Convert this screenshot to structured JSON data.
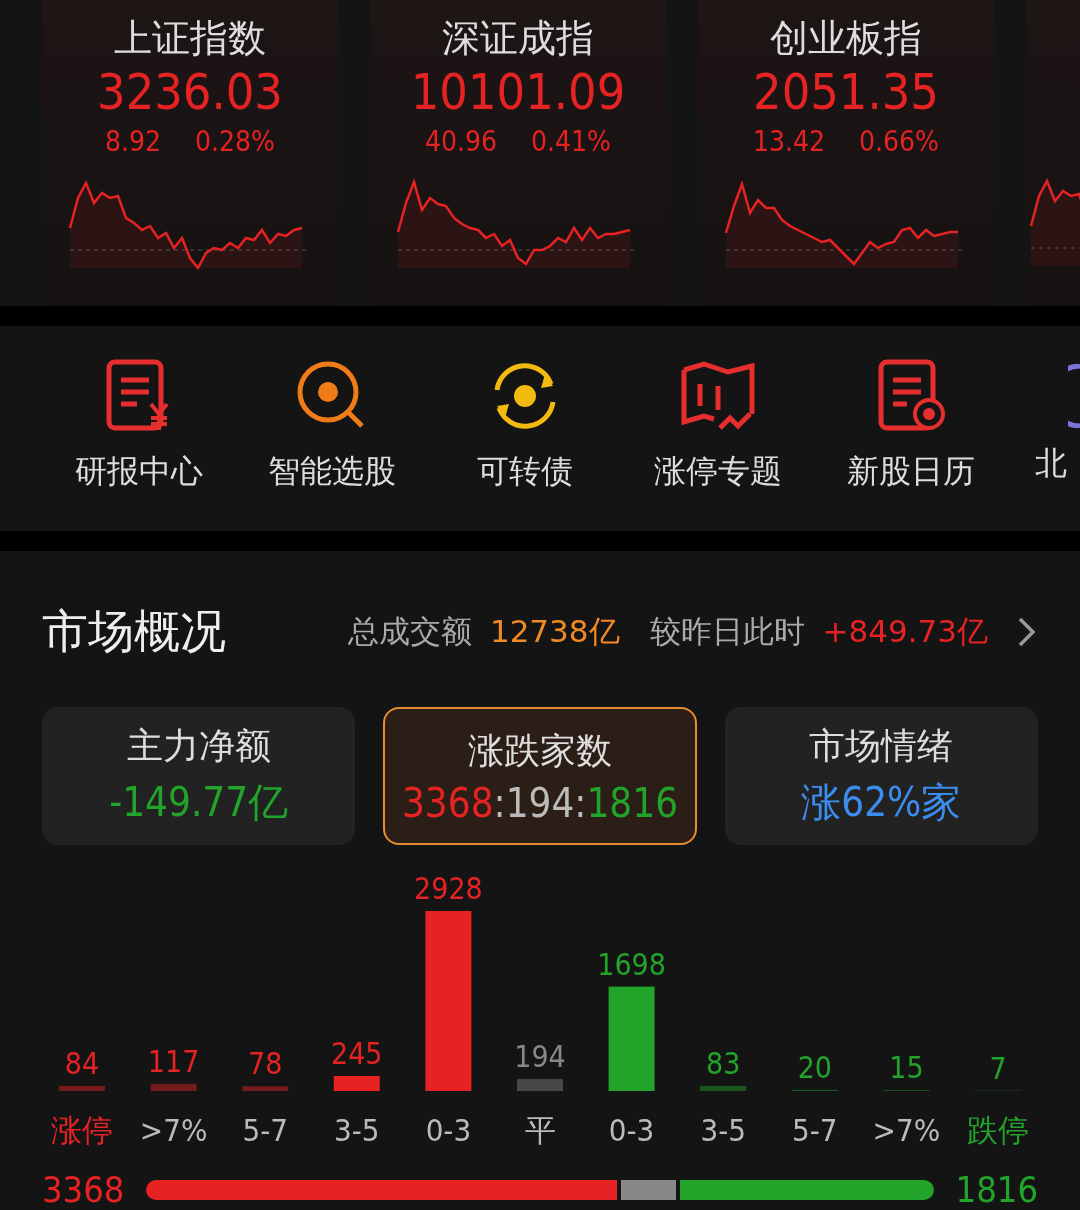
{
  "indices": [
    {
      "name": "上证指数",
      "value": "3236.03",
      "change": "8.92",
      "percent": "0.28%"
    },
    {
      "name": "深证成指",
      "value": "10101.09",
      "change": "40.96",
      "percent": "0.41%"
    },
    {
      "name": "创业板指",
      "value": "2051.35",
      "change": "13.42",
      "percent": "0.66%"
    }
  ],
  "shortcuts": [
    {
      "label": "研报中心",
      "kind": "report"
    },
    {
      "label": "智能选股",
      "kind": "pick"
    },
    {
      "label": "可转债",
      "kind": "bond"
    },
    {
      "label": "涨停专题",
      "kind": "topic"
    },
    {
      "label": "新股日历",
      "kind": "ipo"
    },
    {
      "label": "北",
      "kind": "partial"
    }
  ],
  "overview": {
    "title": "市场概况",
    "turnover_label": "总成交额",
    "turnover": "12738亿",
    "compare_label": "较昨日此时",
    "compare": "+849.73亿",
    "tabs": [
      {
        "title": "主力净额",
        "value": "-149.77亿",
        "color": "#22a32a",
        "selected": false
      },
      {
        "title": "涨跌家数",
        "parts": [
          "3368",
          ":",
          "194",
          ":",
          "1816"
        ],
        "selected": true
      },
      {
        "title": "市场情绪",
        "value": "涨62%家",
        "color": "#3b8ef0",
        "selected": false
      }
    ],
    "chart_data": {
      "type": "bar",
      "categories": [
        "涨停",
        ">7%",
        "5-7",
        "3-5",
        "0-3",
        "平",
        "0-3",
        "3-5",
        "5-7",
        ">7%",
        "跌停"
      ],
      "data_labels": true,
      "values": [
        84,
        117,
        78,
        245,
        2928,
        194,
        1698,
        83,
        20,
        15,
        7
      ]
    },
    "ratio": {
      "up": "3368",
      "flat": "194",
      "down": "1816"
    }
  }
}
